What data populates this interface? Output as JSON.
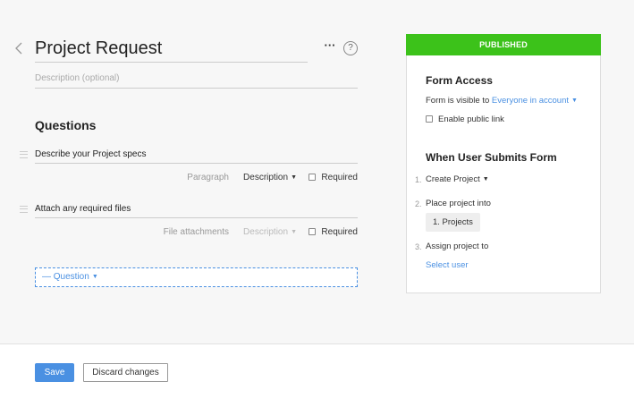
{
  "header": {
    "title": "Project Request",
    "more_label": "···",
    "help_label": "?"
  },
  "description": {
    "placeholder": "Description (optional)"
  },
  "questions": {
    "heading": "Questions",
    "items": [
      {
        "text": "Describe your Project specs",
        "type": "Paragraph",
        "description": "Description",
        "required_label": "Required",
        "required": false
      },
      {
        "text": "Attach any required files",
        "type": "File attachments",
        "description": "Description",
        "required_label": "Required",
        "required": false
      }
    ],
    "new_question_label": "— Question"
  },
  "panel": {
    "status": "PUBLISHED",
    "status_color": "#3cc21a",
    "form_access": {
      "heading": "Form Access",
      "visible_prefix": "Form is visible to",
      "visible_value": "Everyone in account",
      "public_link_label": "Enable public link",
      "public_link_enabled": false
    },
    "submit": {
      "heading": "When User Submits Form",
      "steps": [
        {
          "num": "1.",
          "label": "Create",
          "value": "Project"
        },
        {
          "num": "2.",
          "label": "Place project into",
          "value": "1. Projects"
        },
        {
          "num": "3.",
          "label": "Assign project to",
          "value": "Select user"
        }
      ]
    }
  },
  "footer": {
    "save_label": "Save",
    "discard_label": "Discard changes"
  },
  "colors": {
    "accent": "#4a90e2",
    "published": "#3cc21a"
  }
}
